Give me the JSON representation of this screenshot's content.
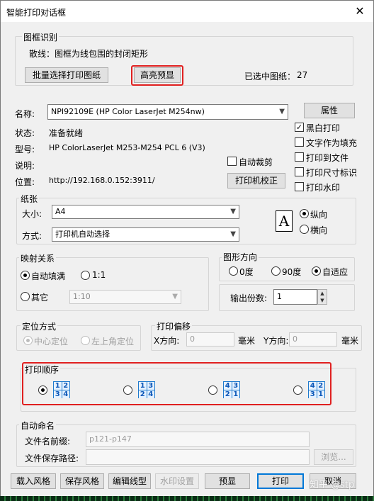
{
  "window": {
    "title": "智能打印对话框",
    "close_glyph": "✕"
  },
  "frame_recog": {
    "group_title": "图框识别",
    "scatter_text": "散线：图框为线包围的封闭矩形",
    "batch_btn": "批量选择打印图纸",
    "highlight_btn": "高亮预显",
    "selected_label": "已选中图纸：",
    "selected_count": "27"
  },
  "printer": {
    "name_label": "名称:",
    "name_value": "NPI92109E (HP Color LaserJet M254nw)",
    "props_btn": "属性",
    "status_label": "状态:",
    "status_value": "准备就绪",
    "model_label": "型号:",
    "model_value": "HP ColorLaserJet M253-M254 PCL 6 (V3)",
    "desc_label": "说明:",
    "loc_label": "位置:",
    "loc_value": "http://192.168.0.152:3911/",
    "auto_crop": "自动裁剪",
    "calibrate_btn": "打印机校正",
    "options": [
      {
        "label": "黑白打印",
        "checked": true
      },
      {
        "label": "文字作为填充",
        "checked": false
      },
      {
        "label": "打印到文件",
        "checked": false
      },
      {
        "label": "打印尺寸标识",
        "checked": false
      },
      {
        "label": "打印水印",
        "checked": false
      }
    ]
  },
  "paper": {
    "group_title": "纸张",
    "size_label": "大小:",
    "size_value": "A4",
    "mode_label": "方式:",
    "mode_value": "打印机自动选择",
    "orient_icon_letter": "A",
    "portrait": "纵向",
    "landscape": "横向"
  },
  "mapping": {
    "group_title": "映射关系",
    "auto_fill": "自动填满",
    "one_to_one": "1:1",
    "other": "其它",
    "ratio_value": "1:10"
  },
  "direction": {
    "group_title": "图形方向",
    "options": [
      "0度",
      "90度",
      "自适应"
    ],
    "copies_label": "输出份数:",
    "copies_value": "1"
  },
  "positioning": {
    "group_title": "定位方式",
    "center": "中心定位",
    "top_left": "左上角定位"
  },
  "offset": {
    "group_title": "打印偏移",
    "x_label": "X方向:",
    "x_value": "0",
    "y_label": "Y方向:",
    "y_value": "0",
    "unit": "毫米"
  },
  "print_order": {
    "group_title": "打印顺序",
    "orders": [
      [
        "1",
        "2",
        "3",
        "4"
      ],
      [
        "1",
        "3",
        "2",
        "4"
      ],
      [
        "4",
        "3",
        "2",
        "1"
      ],
      [
        "4",
        "2",
        "3",
        "1"
      ]
    ]
  },
  "auto_naming": {
    "group_title": "自动命名",
    "prefix_label": "文件名前缀:",
    "prefix_value": "p121-p147",
    "path_label": "文件保存路径:",
    "browse_btn": "浏览..."
  },
  "buttons": {
    "load_style": "载入风格",
    "save_style": "保存风格",
    "edit_linetype": "编辑线型",
    "watermark_settings": "水印设置",
    "preview": "预显",
    "print": "打印",
    "cancel": "取消"
  },
  "watermark_text": "知乎 @stp"
}
